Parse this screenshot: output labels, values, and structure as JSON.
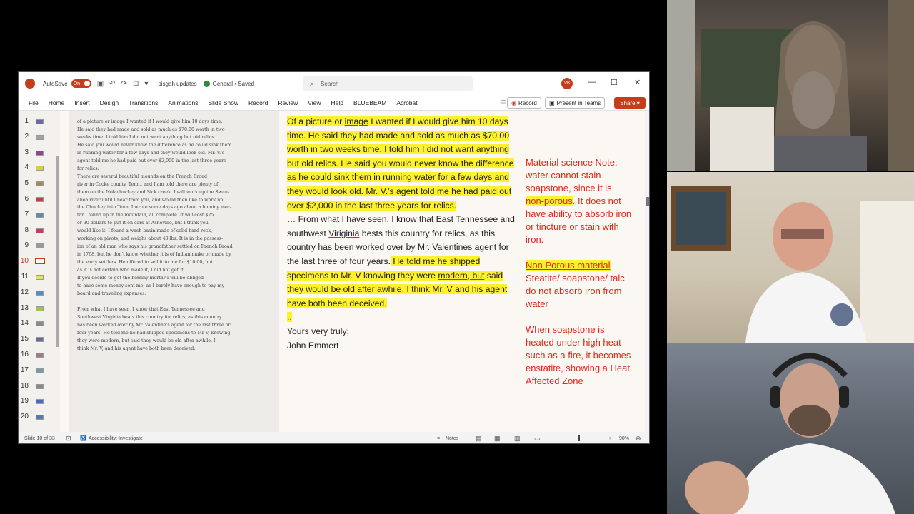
{
  "window": {
    "autosave_label": "AutoSave",
    "autosave_state": "On",
    "doc_name": "pisgah updates",
    "sensitivity": "General • Saved",
    "search_placeholder": "Search",
    "user_initials": "VB"
  },
  "menu": {
    "items": [
      "File",
      "Home",
      "Insert",
      "Design",
      "Transitions",
      "Animations",
      "Slide Show",
      "Record",
      "Review",
      "View",
      "Help",
      "BLUEBEAM",
      "Acrobat"
    ],
    "record_btn": "Record",
    "teams_btn": "Present in Teams",
    "share_btn": "Share"
  },
  "slide_panel": {
    "numbers": [
      "1",
      "2",
      "3",
      "4",
      "5",
      "6",
      "7",
      "8",
      "9",
      "10",
      "11",
      "12",
      "13",
      "14",
      "15",
      "16",
      "17",
      "18",
      "19",
      "20"
    ],
    "active": "10"
  },
  "scan_lines": [
    "of a picture or image I wanted if I would give him 10 days time.",
    "He said they had made and sold as much as $70.00 worth in two",
    "weeks time.  I told him I did not want anything but old relics.",
    "He said you would never know the difference as he could sink them",
    "in running water for a few days and they would look old.   Mr. V.'s",
    "agent told me he had paid out over $2,000 in the last three years",
    "for relics.",
    "        There are several beautiful mounds on the French Broad",
    "river in Cocke county, Tenn., and I am told there are plenty of",
    "them on the Nolachuckey and Sick creek.   I will work up the Swan-",
    "anoa river until I hear from you, and would then like to work up",
    "the Chuckey into Tenn.   I wrote some days ago about a hominy mor-",
    "tar I found up in the mountain, all complete.   It will cost $25.",
    "or 30 dollars to put it on cars at Asheville, but I think you",
    "would like it.   I found a wash basin made of solid hard rock,",
    "working on pivots, and weighs about 40 lbs.   It is in the possess-",
    "ion of an old man who says his grandfather settled on French Broad",
    "in 1768, but he don't know whether it is of Indian make or made by",
    "the early settlers.   He offered to sell it to me for $10.00, but",
    "as it is not certain who made it, I did not get it.",
    "        If you decide to get the hominy mortar I will be obliged",
    "to have some money sent me, as I barely have enough to pay my",
    "board and traveling expenses.",
    "",
    "        From what I have seen, I know that East Tennessee and",
    "Southwest Virginia beats this country for relics, as this country",
    "has been worked over by Mr. Valentine's agent for the last three or",
    "four years.   He told me he had shipped specimens to Mr V, knowing",
    "they were modern, but said they would be old after awhile.   I",
    "think Mr. V, and his agent have both been deceived."
  ],
  "main_text": {
    "p1_a": "Of a picture or ",
    "p1_image": "image",
    "p1_b": " I wanted if I would give him 10 days time.  He said they had made and sold as much as $70.00 worth in two weeks time.  I told him I did not want anything but old relics.  He said you would never know the difference as he could sink them in running water for a few days and they would look old.  Mr. V.'s agent told me he had paid out over $2,000 in the last three years for relics.",
    "p2_a": "… From what I have seen, I know that East Tennessee and southwest ",
    "p2_virginia": "Viriginia",
    "p2_b": " bests this country for relics, as this country has been worked over by Mr. Valentines agent for the last three of four years.",
    "p2_hl_a": " He told me he shipped specimens to Mr. V knowing they were ",
    "p2_modern": "modern, but",
    "p2_hl_b": " said they would be old after awhile. I think Mr. V and his agent have both been deceived.",
    "dots": "..",
    "closing": "Yours very truly;",
    "signature": "John Emmert"
  },
  "notes": {
    "n1_a": "Material science Note: water cannot stain soapstone, since it is ",
    "n1_non": "non-porous",
    "n1_b": ". It does not have ability to absorb iron or tincture or stain with iron.",
    "n2_title": "Non Porous material",
    "n2_body": "Steatite/ soapstone/ talc do not absorb iron from water",
    "n3_a": "When soapstone is heated under high heat such as a fire, it becomes enstatite, showing a ",
    "n3_hl": "Heat Affected Zone"
  },
  "status": {
    "slide_count": "Slide 10 of 33",
    "accessibility": "Accessibility: Investigate",
    "notes": "Notes",
    "zoom": "90%"
  },
  "colors": {
    "accent": "#c43e1c",
    "highlight": "#fdf130",
    "note_red": "#e0281c"
  }
}
